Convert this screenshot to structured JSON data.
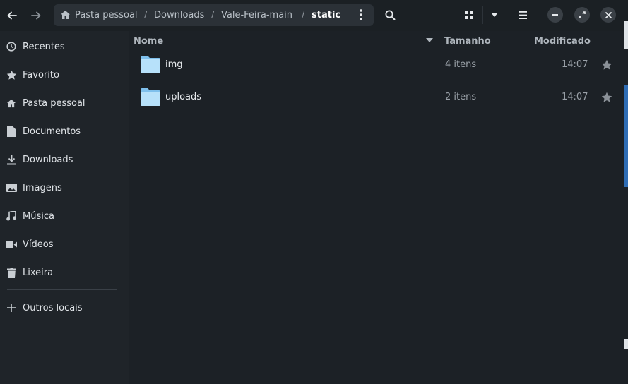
{
  "toolbar": {
    "back_icon": "arrow-left-icon",
    "forward_icon": "arrow-right-icon",
    "search_icon": "search-icon",
    "grid_icon": "grid-view-icon",
    "dropdown_icon": "chevron-down-icon",
    "menu_icon": "hamburger-menu-icon",
    "minimize_icon": "minimize-icon",
    "maximize_icon": "maximize-icon",
    "close_icon": "close-icon"
  },
  "breadcrumb": {
    "home_icon": "home-icon",
    "items": [
      "Pasta pessoal",
      "Downloads",
      "Vale-Feira-main",
      "static"
    ],
    "separator": "/"
  },
  "sidebar": {
    "items": [
      {
        "label": "Recentes",
        "icon": "clock-icon"
      },
      {
        "label": "Favorito",
        "icon": "star-icon"
      },
      {
        "label": "Pasta pessoal",
        "icon": "home-icon"
      },
      {
        "label": "Documentos",
        "icon": "document-icon"
      },
      {
        "label": "Downloads",
        "icon": "download-icon"
      },
      {
        "label": "Imagens",
        "icon": "image-icon"
      },
      {
        "label": "Música",
        "icon": "music-icon"
      },
      {
        "label": "Vídeos",
        "icon": "video-icon"
      },
      {
        "label": "Lixeira",
        "icon": "trash-icon"
      }
    ],
    "other_locations": {
      "label": "Outros locais",
      "icon": "plus-icon"
    }
  },
  "columns": {
    "name": "Nome",
    "size": "Tamanho",
    "modified": "Modificado"
  },
  "files": [
    {
      "name": "img",
      "size": "4 itens",
      "modified": "14:07",
      "icon": "folder-icon"
    },
    {
      "name": "uploads",
      "size": "2 itens",
      "modified": "14:07",
      "icon": "folder-icon"
    }
  ],
  "colors": {
    "background": "#1c2126",
    "sidebar": "#1f2429",
    "folder": "#a9d8f6",
    "accent": "#2f6db5"
  }
}
